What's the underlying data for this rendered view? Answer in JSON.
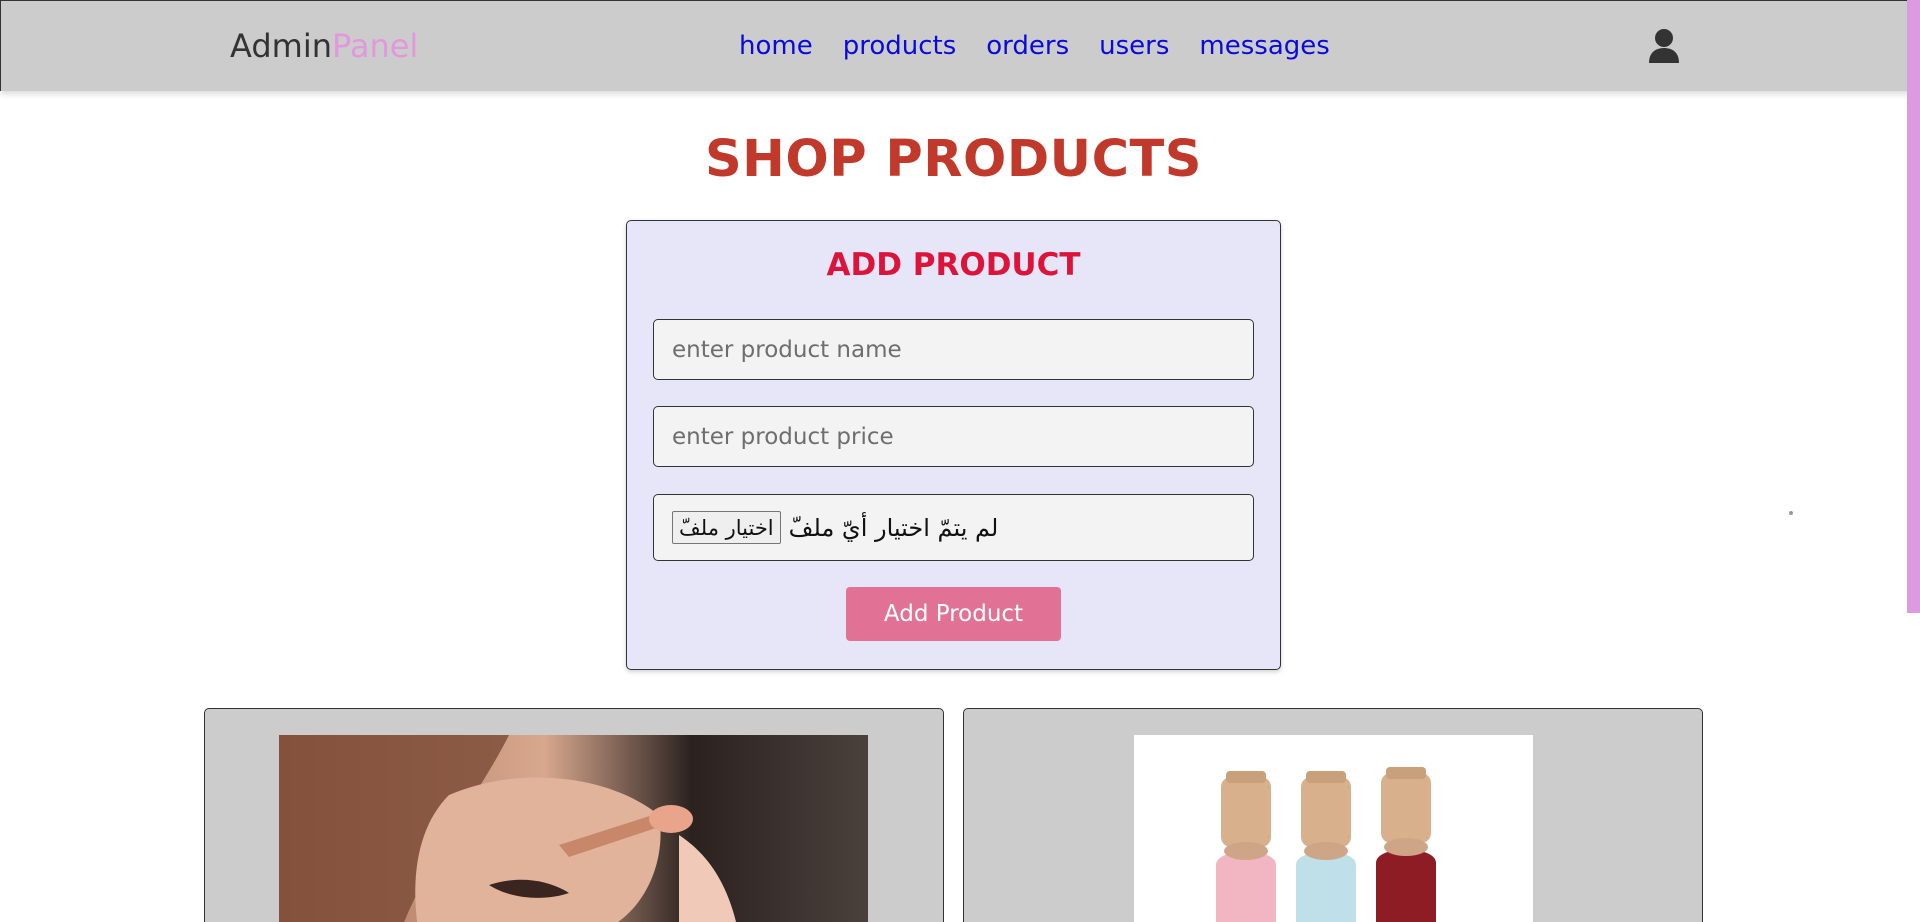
{
  "header": {
    "logo_main": "Admin",
    "logo_accent": "Panel",
    "nav": [
      {
        "label": "home"
      },
      {
        "label": "products"
      },
      {
        "label": "orders"
      },
      {
        "label": "users"
      },
      {
        "label": "messages"
      }
    ],
    "user_icon": "user-icon"
  },
  "page": {
    "title": "SHOP PRODUCTS"
  },
  "form": {
    "title": "ADD PRODUCT",
    "name_placeholder": "enter product name",
    "price_placeholder": "enter product price",
    "file_button": "اختيار ملفّ",
    "file_status": "لم يتمّ اختيار أيّ ملفّ",
    "submit": "Add Product"
  },
  "products": [
    {
      "image": "makeup-application-photo"
    },
    {
      "image": "nail-polish-bottles-photo"
    }
  ],
  "colors": {
    "header_bg": "#cccccc",
    "logo_accent": "#e298dc",
    "nav_link": "#0a0adc",
    "page_title": "#c0392b",
    "form_title": "#dc143c",
    "form_bg": "#e6e6f8",
    "submit_bg": "#e17296"
  }
}
